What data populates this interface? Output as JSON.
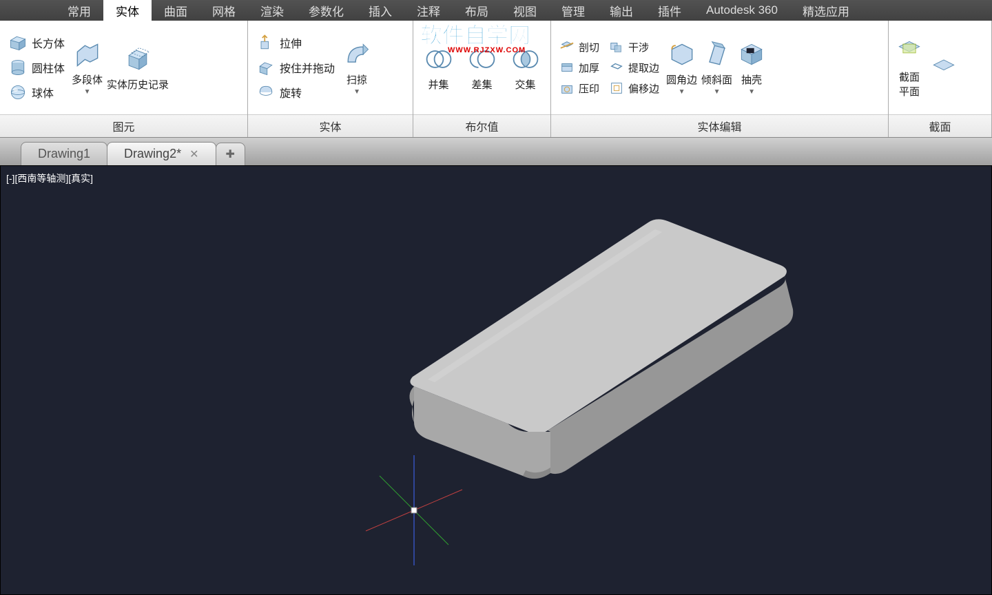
{
  "menubar": {
    "items": [
      "常用",
      "实体",
      "曲面",
      "网格",
      "渲染",
      "参数化",
      "插入",
      "注释",
      "布局",
      "视图",
      "管理",
      "输出",
      "插件",
      "Autodesk 360",
      "精选应用"
    ],
    "activeIndex": 1
  },
  "ribbon": {
    "panels": [
      {
        "title": "图元",
        "shapes": {
          "box": "长方体",
          "cylinder": "圆柱体",
          "sphere": "球体"
        },
        "polysolid": "多段体",
        "history": "实体历史记录"
      },
      {
        "title": "实体",
        "extrude": "拉伸",
        "presspull": "按住并拖动",
        "revolve": "旋转",
        "sweep": "扫掠"
      },
      {
        "title": "布尔值",
        "union": "并集",
        "subtract": "差集",
        "intersect": "交集"
      },
      {
        "title": "实体编辑",
        "slice": "剖切",
        "thicken": "加厚",
        "imprint": "压印",
        "interfere": "干涉",
        "extractEdges": "提取边",
        "offsetEdge": "偏移边",
        "fillet": "圆角边",
        "taper": "倾斜面",
        "shell": "抽壳"
      },
      {
        "title": "截面",
        "sectionPlane": "截面\n平面"
      }
    ]
  },
  "tabs": {
    "items": [
      {
        "name": "Drawing1",
        "active": false,
        "closable": false
      },
      {
        "name": "Drawing2*",
        "active": true,
        "closable": true
      }
    ]
  },
  "viewport": {
    "label": "[-][西南等轴测][真实]"
  },
  "watermark": {
    "text": "软件自学网",
    "url": "WWW.RJZXW.COM"
  }
}
